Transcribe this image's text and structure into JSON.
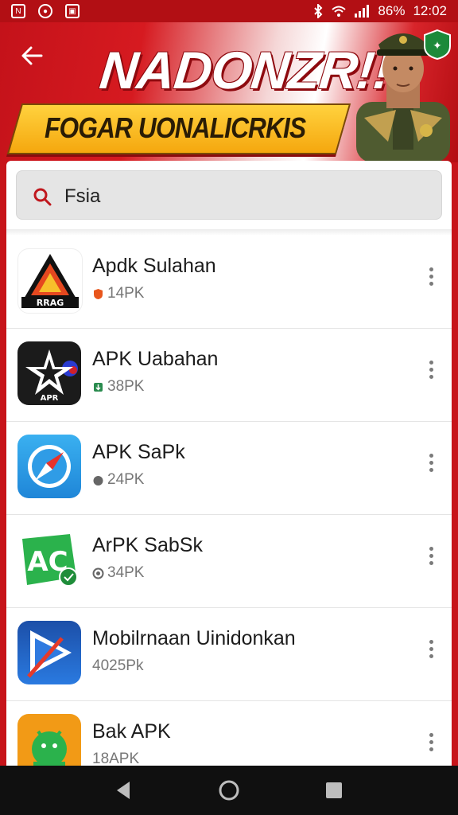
{
  "status": {
    "battery": "86%",
    "time": "12:02"
  },
  "header": {
    "brand": "NADONZR!!",
    "banner": "FOGAR UONALICRKIS"
  },
  "search": {
    "value": "Fsia"
  },
  "apps": [
    {
      "name": "Apdk Sulahan",
      "meta": "14PK",
      "icon": "warning-triangle-icon",
      "color": "#e24a1e"
    },
    {
      "name": "APK Uabahan",
      "meta": "38PK",
      "icon": "star-emblem-icon",
      "color": "#1b1b1b"
    },
    {
      "name": "APK SaPk",
      "meta": "24PK",
      "icon": "compass-icon",
      "color": "#2ea2e8"
    },
    {
      "name": "ArPK SabSk",
      "meta": "34PK",
      "icon": "ac-logo-icon",
      "color": "#2bb24c"
    },
    {
      "name": "Mobilrnaan Uinidonkan",
      "meta": "4025Pk",
      "icon": "play-store-icon",
      "color": "#1e60c8"
    },
    {
      "name": "Bak APK",
      "meta": "18APK",
      "icon": "android-icon",
      "color": "#f29a16"
    }
  ]
}
